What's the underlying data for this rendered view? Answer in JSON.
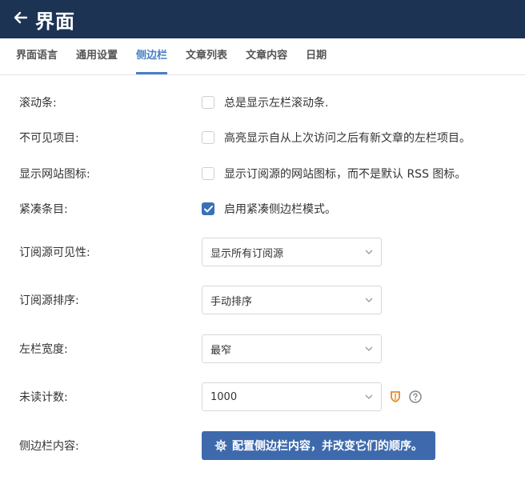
{
  "header": {
    "title": "界面",
    "back_icon": "arrow-left-icon"
  },
  "tabs": [
    {
      "label": "界面语言",
      "active": false
    },
    {
      "label": "通用设置",
      "active": false
    },
    {
      "label": "侧边栏",
      "active": true
    },
    {
      "label": "文章列表",
      "active": false
    },
    {
      "label": "文章内容",
      "active": false
    },
    {
      "label": "日期",
      "active": false
    }
  ],
  "settings": {
    "scrollbar": {
      "label": "滚动条:",
      "text": "总是显示左栏滚动条.",
      "checked": false
    },
    "invisible": {
      "label": "不可见项目:",
      "text": "高亮显示自从上次访问之后有新文章的左栏项目。",
      "checked": false
    },
    "favicons": {
      "label": "显示网站图标:",
      "text": "显示订阅源的网站图标，而不是默认 RSS 图标。",
      "checked": false
    },
    "compact": {
      "label": "紧凑条目:",
      "text": "启用紧凑侧边栏模式。",
      "checked": true
    },
    "visibility": {
      "label": "订阅源可见性:",
      "value": "显示所有订阅源"
    },
    "sort": {
      "label": "订阅源排序:",
      "value": "手动排序"
    },
    "width": {
      "label": "左栏宽度:",
      "value": "最窄"
    },
    "unread": {
      "label": "未读计数:",
      "value": "1000",
      "icons": [
        "shield-badge-icon",
        "help-circle-icon"
      ]
    },
    "content": {
      "label": "侧边栏内容:",
      "button": "配置侧边栏内容，并改变它们的顺序。"
    }
  },
  "colors": {
    "header": "#1c3354",
    "accent": "#4a80c6",
    "button": "#3e6aad",
    "badge": "#e8872a"
  }
}
